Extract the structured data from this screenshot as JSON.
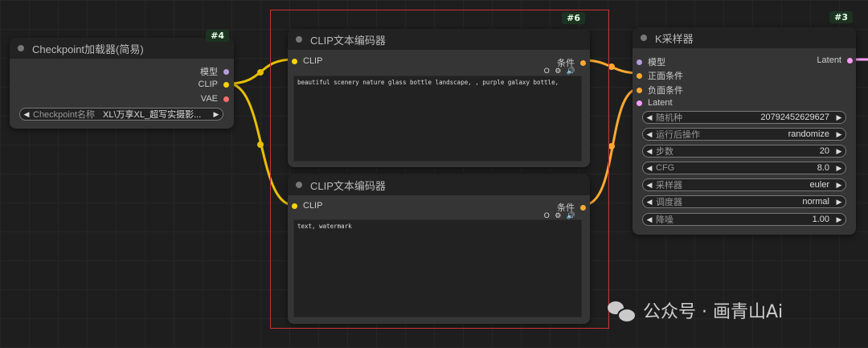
{
  "node_checkpoint": {
    "id": "#4",
    "title": "Checkpoint加载器(简易)",
    "outputs": [
      "模型",
      "CLIP",
      "VAE"
    ],
    "widget": {
      "label": "Checkpoint名称",
      "value": "XL\\万享XL_超写实摄影..."
    }
  },
  "node_clip_pos": {
    "id": "#6",
    "title": "CLIP文本编码器",
    "input": "CLIP",
    "output": "条件",
    "text": "beautiful scenery nature glass bottle landscape, , purple galaxy bottle,"
  },
  "node_clip_neg": {
    "title": "CLIP文本编码器",
    "input": "CLIP",
    "output": "条件",
    "text": "text, watermark"
  },
  "node_ksampler": {
    "id": "#3",
    "title": "K采样器",
    "inputs": [
      "模型",
      "正面条件",
      "负面条件",
      "Latent"
    ],
    "output": "Latent",
    "widgets": [
      {
        "label": "随机种",
        "value": "20792452629627"
      },
      {
        "label": "运行后操作",
        "value": "randomize"
      },
      {
        "label": "步数",
        "value": "20"
      },
      {
        "label": "CFG",
        "value": "8.0"
      },
      {
        "label": "采样器",
        "value": "euler"
      },
      {
        "label": "调度器",
        "value": "normal"
      },
      {
        "label": "降噪",
        "value": "1.00"
      }
    ]
  },
  "icons": {
    "widget_icons": "O ⚙ 🔊"
  },
  "colors": {
    "model": "#b39ddb",
    "clip": "#ffd500",
    "vae": "#ff6e6e",
    "conditioning": "#ffa931",
    "latent": "#ff9cf9",
    "selection": "#c83232"
  },
  "watermark": "公众号 · 画青山Ai"
}
